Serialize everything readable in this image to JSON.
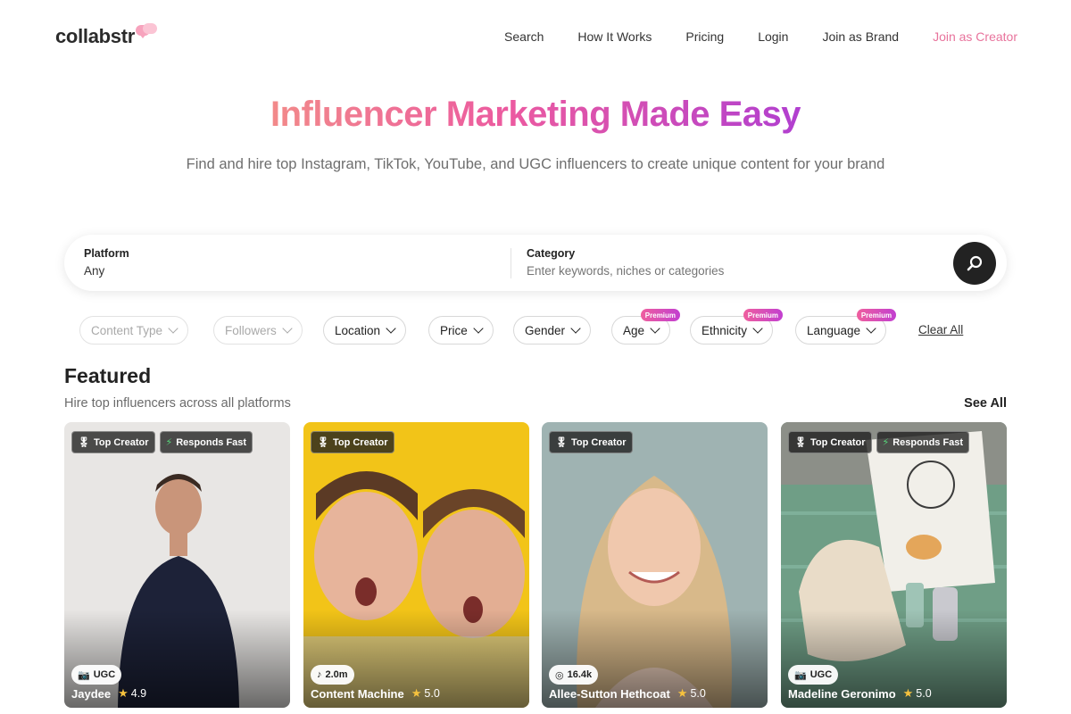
{
  "brand": {
    "name": "collabstr"
  },
  "nav": [
    {
      "label": "Search"
    },
    {
      "label": "How It Works"
    },
    {
      "label": "Pricing"
    },
    {
      "label": "Login"
    },
    {
      "label": "Join as Brand"
    },
    {
      "label": "Join as Creator"
    }
  ],
  "hero": {
    "title": "Influencer Marketing Made Easy",
    "subtitle": "Find and hire top Instagram, TikTok, YouTube, and UGC influencers to create unique content for your brand"
  },
  "search": {
    "platform_label": "Platform",
    "platform_value": "Any",
    "category_label": "Category",
    "category_placeholder": "Enter keywords, niches or categories"
  },
  "filters": [
    {
      "label": "Content Type",
      "disabled": true,
      "premium": ""
    },
    {
      "label": "Followers",
      "disabled": true,
      "premium": ""
    },
    {
      "label": "Location",
      "disabled": false,
      "premium": ""
    },
    {
      "label": "Price",
      "disabled": false,
      "premium": ""
    },
    {
      "label": "Gender",
      "disabled": false,
      "premium": ""
    },
    {
      "label": "Age",
      "disabled": false,
      "premium": "Premium"
    },
    {
      "label": "Ethnicity",
      "disabled": false,
      "premium": "Premium"
    },
    {
      "label": "Language",
      "disabled": false,
      "premium": "Premium"
    }
  ],
  "clear_all": "Clear All",
  "featured": {
    "title": "Featured",
    "subtitle": "Hire top influencers across all platforms",
    "see_all": "See All",
    "cards": [
      {
        "badges": [
          "Top Creator",
          "Responds Fast"
        ],
        "stat_icon": "camera-icon",
        "stat": "UGC",
        "name": "Jaydee",
        "rating": "4.9"
      },
      {
        "badges": [
          "Top Creator"
        ],
        "stat_icon": "tiktok-icon",
        "stat": "2.0m",
        "name": "Content Machine",
        "rating": "5.0"
      },
      {
        "badges": [
          "Top Creator"
        ],
        "stat_icon": "instagram-icon",
        "stat": "16.4k",
        "name": "Allee-Sutton Hethcoat",
        "rating": "5.0"
      },
      {
        "badges": [
          "Top Creator",
          "Responds Fast"
        ],
        "stat_icon": "camera-icon",
        "stat": "UGC",
        "name": "Madeline Geronimo",
        "rating": "5.0"
      }
    ]
  },
  "colors": {
    "accent_pink": "#e8739c",
    "gradient_start": "#f28a8a",
    "gradient_mid": "#ec5aa0",
    "gradient_end": "#b13fd0",
    "star": "#f6c23e"
  }
}
